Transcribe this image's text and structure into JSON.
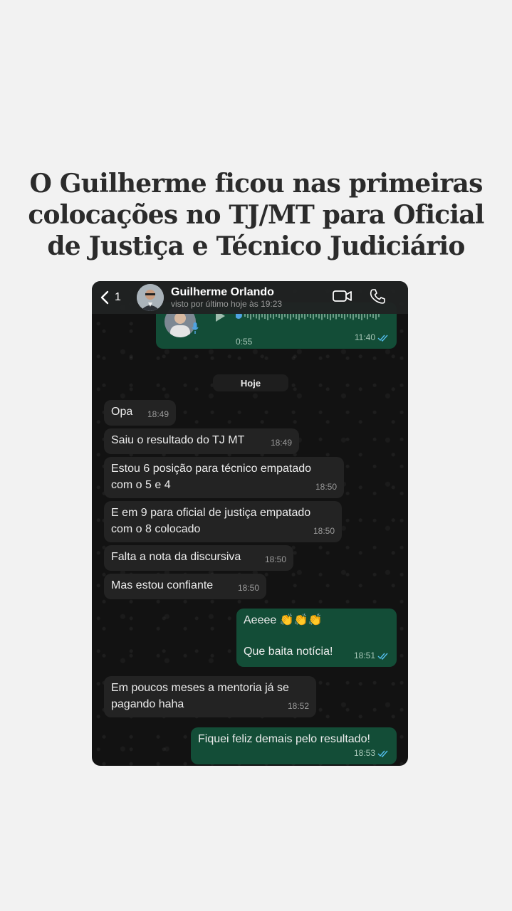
{
  "headline": {
    "line1": "O Guilherme ficou nas primeiras",
    "line2": "colocações no TJ/MT para Oficial",
    "line3": "de Justiça e Técnico Judiciário"
  },
  "header": {
    "back_count": "1",
    "contact_name": "Guilherme Orlando",
    "last_seen": "visto por último hoje às 19:23",
    "icons": [
      "chevron-left-icon",
      "video-camera-icon",
      "phone-icon"
    ]
  },
  "voice_message": {
    "duration": "0:55",
    "time": "11:40"
  },
  "date_divider": "Hoje",
  "messages": [
    {
      "dir": "in",
      "text": "Opa",
      "time": "18:49"
    },
    {
      "dir": "in",
      "text": "Saiu o resultado do TJ MT",
      "time": "18:49"
    },
    {
      "dir": "in",
      "text": "Estou 6 posição para técnico empatado\ncom o 5 e 4",
      "time": "18:50"
    },
    {
      "dir": "in",
      "text": "E em 9 para oficial de justiça empatado\ncom o 8 colocado",
      "time": "18:50"
    },
    {
      "dir": "in",
      "text": "Falta a nota da discursiva",
      "time": "18:50"
    },
    {
      "dir": "in",
      "text": "Mas estou confiante",
      "time": "18:50"
    },
    {
      "dir": "out",
      "text": "Aeeee 👏👏👏\n\nQue baita notícia!",
      "time": "18:51"
    },
    {
      "dir": "in",
      "text": "Em poucos meses a mentoria já se\npagando haha",
      "time": "18:52"
    },
    {
      "dir": "out",
      "text": "Fiquei feliz demais pelo resultado!",
      "time": "18:53"
    }
  ],
  "colors": {
    "incoming_bubble": "#232323",
    "outgoing_bubble": "#134d37",
    "read_ticks": "#53bdeb"
  }
}
